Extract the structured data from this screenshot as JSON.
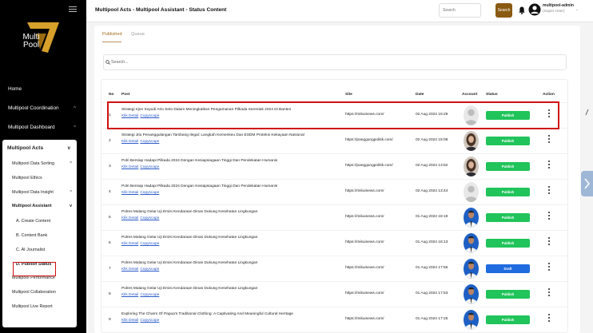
{
  "app": {
    "logo_text_line1": "Multi",
    "logo_text_line2": "Pool",
    "title": "Multipool Acts - Multipool Assistant - Status Content"
  },
  "header": {
    "search_placeholder": "Search",
    "search_button": "Search",
    "user_name": "multipool-admin",
    "user_role": "(Super User)"
  },
  "sidebar": {
    "top_items": [
      {
        "label": "Home",
        "chevron": ""
      },
      {
        "label": "Multipool Coordination",
        "chevron": "^"
      },
      {
        "label": "Multipool Dashboard",
        "chevron": "^"
      }
    ],
    "acts": {
      "label": "Multipool Acts",
      "chevron": "v",
      "items": [
        {
          "label": "Multipool Data Sorting",
          "chevron": "^"
        },
        {
          "label": "Multipool Ethics",
          "chevron": ""
        },
        {
          "label": "Multipool Data Insight",
          "chevron": "^"
        },
        {
          "label": "Multipool Assistant",
          "chevron": "v"
        }
      ],
      "assistant_items": [
        "A. Create Content",
        "B. Content Bank",
        "C. AI Journalist",
        "D. Publish Status"
      ],
      "bottom_items": [
        "Multipool Performance",
        "Multipool Collaboration",
        "Multipool Live Report"
      ]
    }
  },
  "tabs": [
    "Published",
    "Queue"
  ],
  "search": {
    "placeholder": "Search..."
  },
  "table": {
    "headers": [
      "No",
      "Post",
      "Site",
      "Date",
      "Account",
      "Status",
      "Action"
    ],
    "link_detail": "Klik Detail",
    "link_copyscape": "Copyscape",
    "rows": [
      {
        "no": "1",
        "title": "Strategi Irjen Suyudi Ario Seto Dalam Meningkatkan Pengamanan Pilkada Serentak 2024 Di Banten",
        "site": "https://mikuinews.com/",
        "date": "02 Aug 2024 15:29",
        "status": "Publish",
        "avatar": "default"
      },
      {
        "no": "2",
        "title": "Strategi Jitu Penanggulangan Tambang Ilegal: Langkah Kemenkeu Dan ESDM Proteksi Kekayaan Nasional",
        "site": "https://panggungpolitik.com/",
        "date": "02 Aug 2024 15:08",
        "status": "Publish",
        "avatar": "woman"
      },
      {
        "no": "3",
        "title": "Polri Bersiap Hadapi Pilkada 2024 Dengan Kesiapsiagaan Tinggi Dan Pendekatan Humanis",
        "site": "https://panggungpolitik.com/",
        "date": "02 Aug 2024 13:52",
        "status": "Publish",
        "avatar": "woman"
      },
      {
        "no": "4",
        "title": "Polri Bersiap Hadapi Pilkada 2024 Dengan Kesiapsiagaan Tinggi Dan Pendekatan Humanis",
        "site": "https://mikuinews.com/",
        "date": "02 Aug 2024 13:44",
        "status": "Publish",
        "avatar": "default"
      },
      {
        "no": "5",
        "title": "Polres Malang Gelar Uji Emisi Kendaraan Dinas Dukung Kesehatan Lingkungan",
        "site": "https://mikuinews.com/",
        "date": "01 Aug 2024 18:19",
        "status": "Publish",
        "avatar": "man"
      },
      {
        "no": "6",
        "title": "Polres Malang Gelar Uji Emisi Kendaraan Dinas Dukung Kesehatan Lingkungan",
        "site": "https://mikuinews.com/",
        "date": "01 Aug 2024 18:13",
        "status": "Publish",
        "avatar": "man"
      },
      {
        "no": "7",
        "title": "Polres Malang Gelar Uji Emisi Kendaraan Dinas Dukung Kesehatan Lingkungan",
        "site": "https://mikuinews.com/",
        "date": "01 Aug 2024 17:55",
        "status": "Draft",
        "avatar": "man"
      },
      {
        "no": "8",
        "title": "Polres Malang Gelar Uji Emisi Kendaraan Dinas Dukung Kesehatan Lingkungan",
        "site": "https://mikuinews.com/",
        "date": "01 Aug 2024 17:53",
        "status": "Publish",
        "avatar": "man"
      },
      {
        "no": "9",
        "title": "Exploring The Charm Of Papua's Traditional Clothing: A Captivating And Meaningful Cultural Heritage",
        "site": "https://mikuinews.com/",
        "date": "01 Aug 2024 17:25",
        "status": "Publish",
        "avatar": "man"
      }
    ]
  },
  "colors": {
    "publish": "#20c45a",
    "draft": "#1f6be0",
    "accent": "#a06b1c",
    "highlight": "#d01010"
  }
}
